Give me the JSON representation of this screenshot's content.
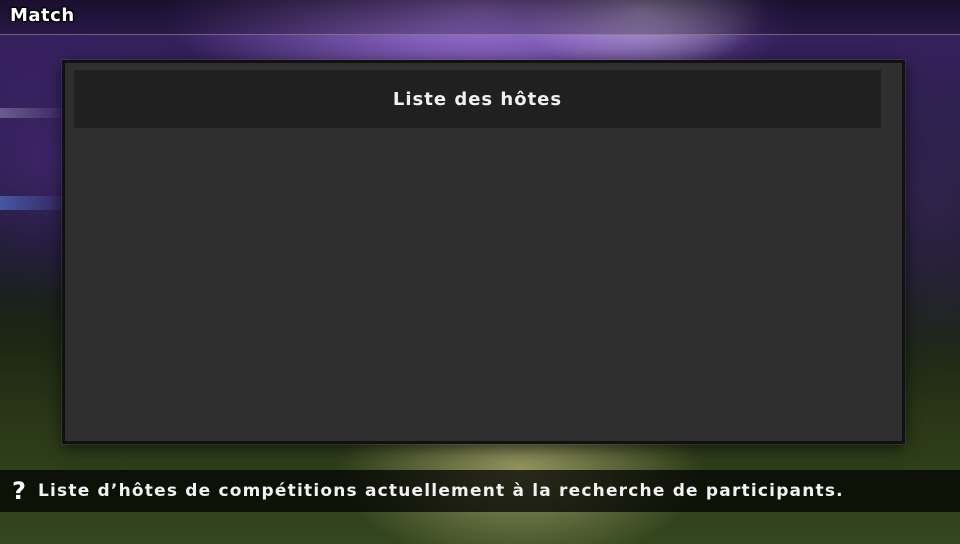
{
  "topbar": {
    "title": "Match"
  },
  "panel": {
    "header_label": "Liste des hôtes",
    "hosts": []
  },
  "help": {
    "icon": "question-mark-icon",
    "icon_glyph": "?",
    "text": "Liste d’hôtes de compétitions actuellement à la recherche de participants."
  }
}
